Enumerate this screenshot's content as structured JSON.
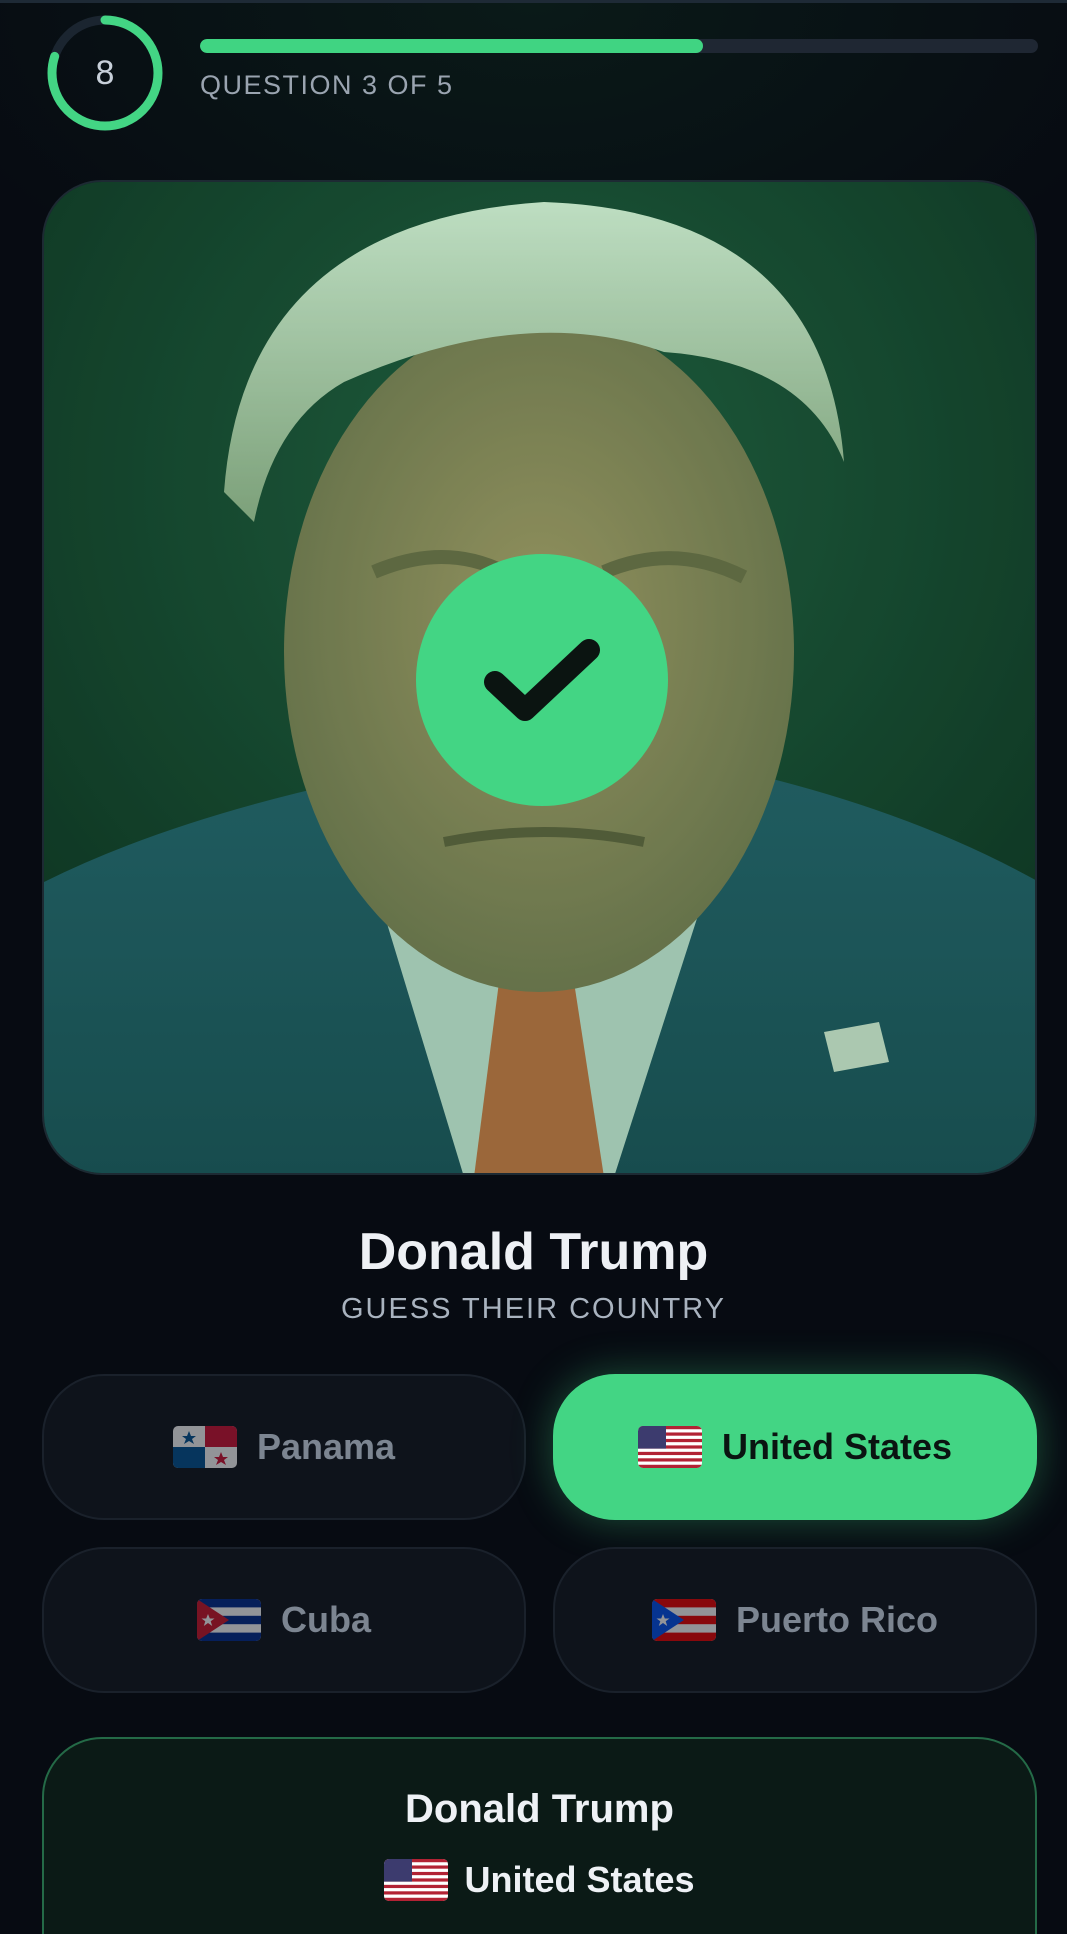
{
  "timer": {
    "seconds": "8",
    "remaining_fraction": 0.8
  },
  "progress": {
    "label": "QUESTION 3 OF 5",
    "fraction": 0.6
  },
  "photo": {
    "status_icon": "check-icon"
  },
  "person": {
    "name": "Donald Trump",
    "prompt": "GUESS THEIR COUNTRY"
  },
  "options": [
    {
      "label": "Panama",
      "flag": "panama-flag",
      "state": "neutral"
    },
    {
      "label": "United States",
      "flag": "usa-flag",
      "state": "correct"
    },
    {
      "label": "Cuba",
      "flag": "cuba-flag",
      "state": "neutral"
    },
    {
      "label": "Puerto Rico",
      "flag": "puerto-rico-flag",
      "state": "neutral"
    }
  ],
  "result": {
    "name": "Donald Trump",
    "country": "United States",
    "flag": "usa-flag"
  },
  "colors": {
    "accent": "#43d584",
    "background": "#070b12",
    "card": "#0e131b"
  }
}
